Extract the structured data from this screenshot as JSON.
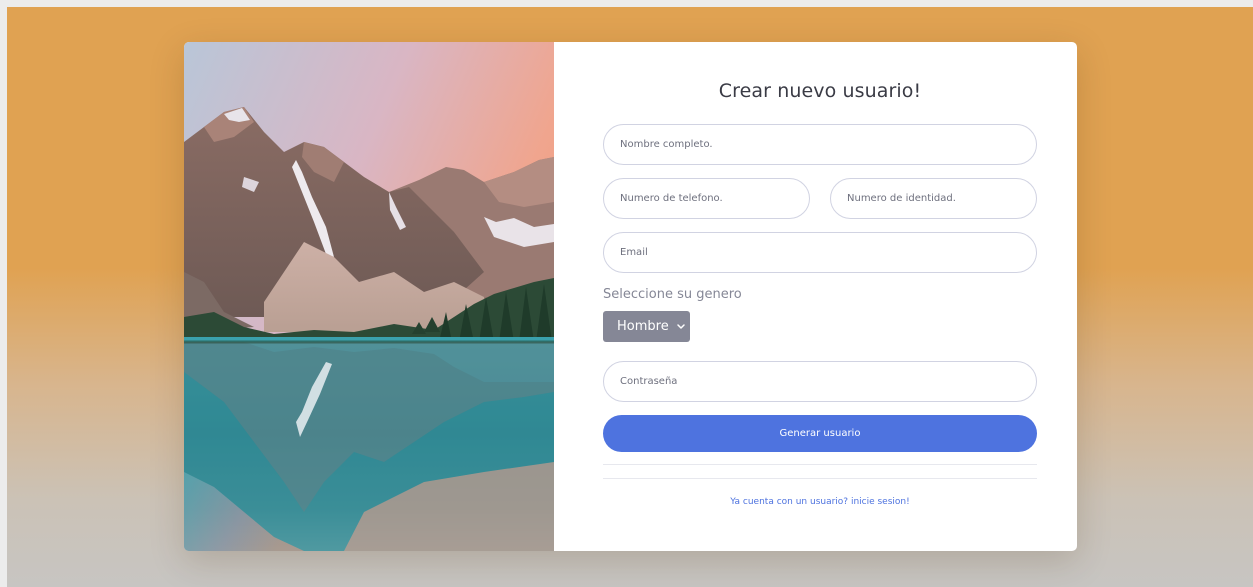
{
  "form": {
    "title": "Crear nuevo usuario!",
    "fullname_placeholder": "Nombre completo.",
    "phone_placeholder": "Numero de telefono.",
    "id_placeholder": "Numero de identidad.",
    "email_placeholder": "Email",
    "gender_label": "Seleccione su genero",
    "gender_selected": "Hombre",
    "password_placeholder": "Contraseña",
    "submit_label": "Generar usuario",
    "login_link": "Ya cuenta con un usuario? inicie sesion!"
  },
  "colors": {
    "primary": "#4e73df",
    "select_bg": "#858796",
    "background_top": "#e0a252",
    "background_bottom": "#c7c5c2"
  },
  "icons": {
    "select_caret": "chevron-down-icon"
  }
}
